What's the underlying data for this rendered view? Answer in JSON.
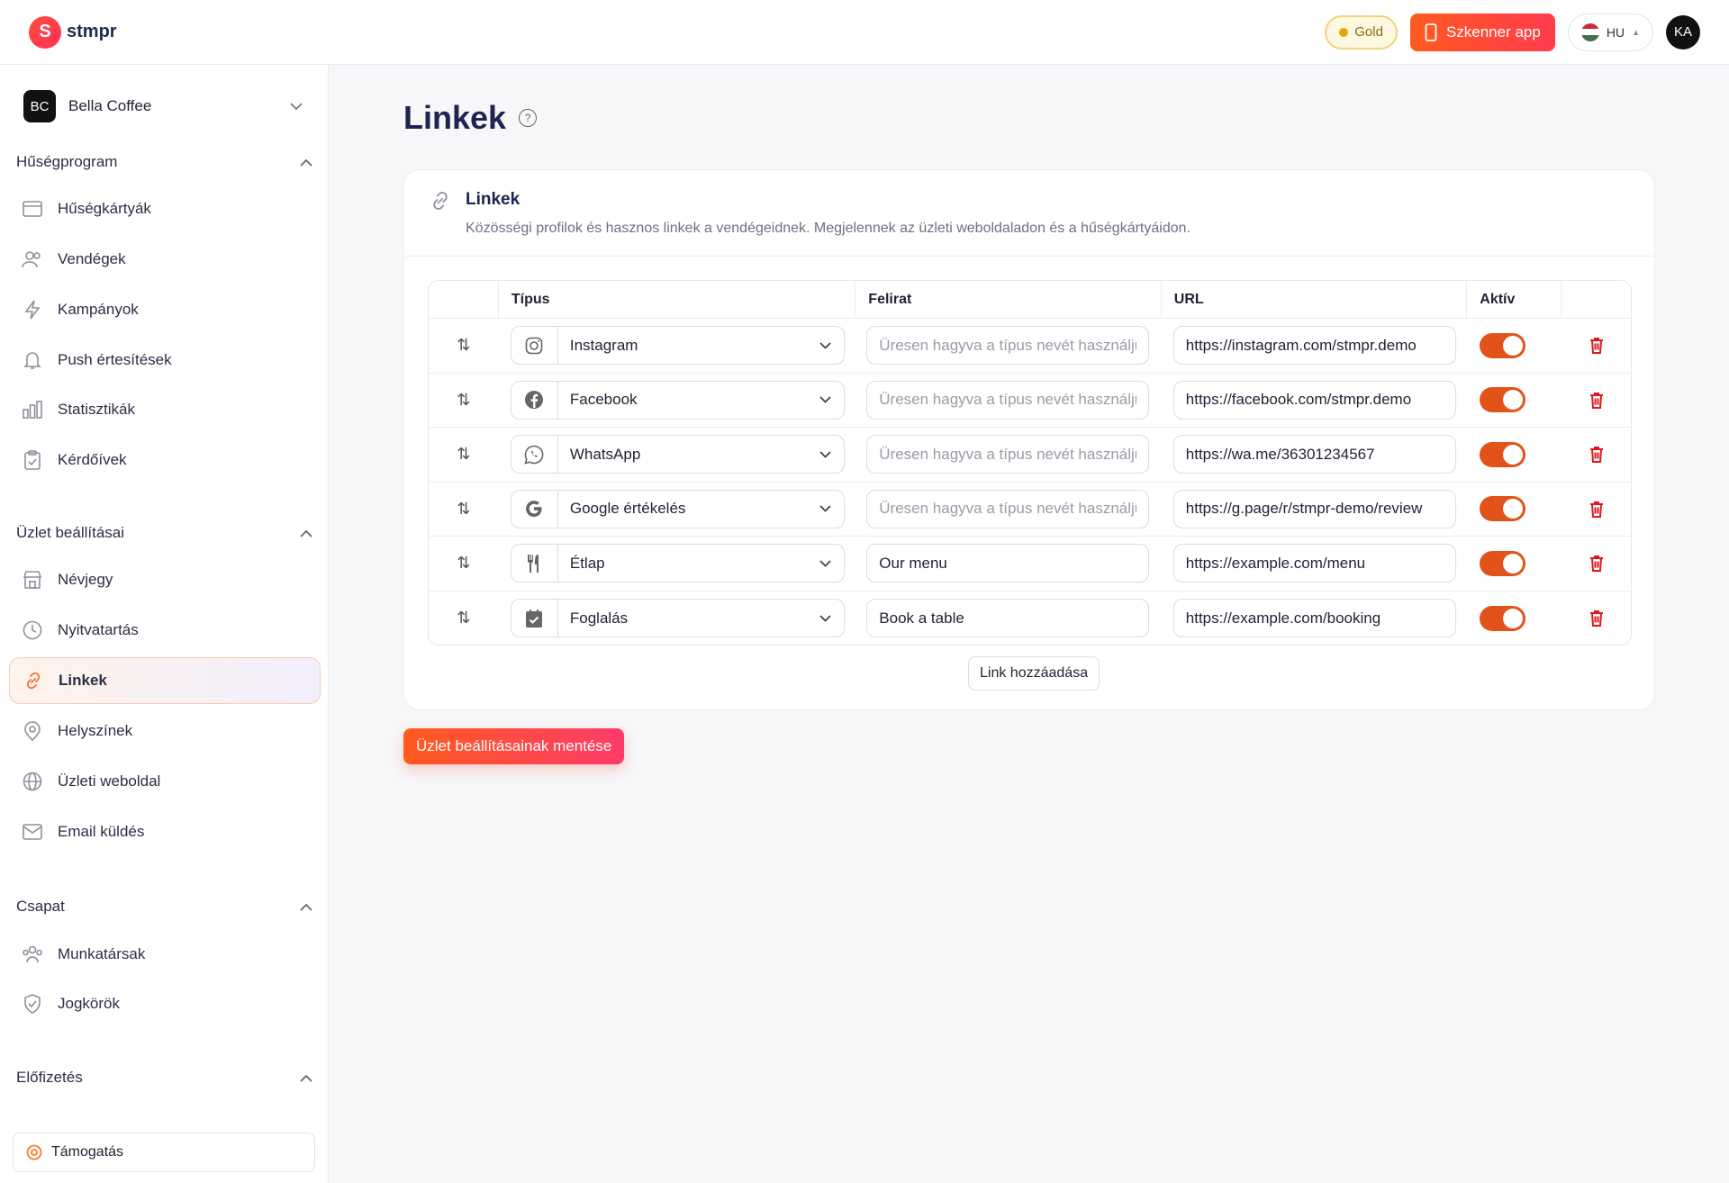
{
  "brand": {
    "name": "stmpr"
  },
  "topbar": {
    "plan_label": "Gold",
    "scanner_label": "Szkenner app",
    "lang_label": "HU",
    "user_initials": "KA"
  },
  "business": {
    "initials": "BC",
    "name": "Bella Coffee"
  },
  "sidebar": {
    "sections": [
      {
        "title": "Hűségprogram"
      },
      {
        "title": "Üzlet beállításai"
      },
      {
        "title": "Csapat"
      },
      {
        "title": "Előfizetés"
      }
    ],
    "items": [
      {
        "label": "Hűségkártyák",
        "icon": "card-icon"
      },
      {
        "label": "Vendégek",
        "icon": "users-icon"
      },
      {
        "label": "Kampányok",
        "icon": "lightning-icon"
      },
      {
        "label": "Push értesítések",
        "icon": "bell-icon"
      },
      {
        "label": "Statisztikák",
        "icon": "chart-icon"
      },
      {
        "label": "Kérdőívek",
        "icon": "clipboard-icon"
      },
      {
        "label": "Névjegy",
        "icon": "store-icon"
      },
      {
        "label": "Nyitvatartás",
        "icon": "clock-icon"
      },
      {
        "label": "Linkek",
        "icon": "link-icon",
        "active": true
      },
      {
        "label": "Helyszínek",
        "icon": "location-icon"
      },
      {
        "label": "Üzleti weboldal",
        "icon": "globe-icon"
      },
      {
        "label": "Email küldés",
        "icon": "mail-icon"
      },
      {
        "label": "Munkatársak",
        "icon": "team-icon"
      },
      {
        "label": "Jogkörök",
        "icon": "shield-icon"
      }
    ],
    "support_label": "Támogatás"
  },
  "page": {
    "title": "Linkek",
    "card_title": "Linkek",
    "card_desc": "Közösségi profilok és hasznos linkek a vendégeidnek. Megjelennek az üzleti weboldaladon és a hűségkártyáidon.",
    "columns": {
      "type": "Típus",
      "label": "Felirat",
      "url": "URL",
      "active": "Aktív"
    },
    "label_placeholder": "Üresen hagyva a típus nevét használjuk",
    "rows": [
      {
        "type": "Instagram",
        "icon": "instagram-icon",
        "label": "",
        "url": "https://instagram.com/stmpr.demo",
        "active": true
      },
      {
        "type": "Facebook",
        "icon": "facebook-icon",
        "label": "",
        "url": "https://facebook.com/stmpr.demo",
        "active": true
      },
      {
        "type": "WhatsApp",
        "icon": "whatsapp-icon",
        "label": "",
        "url": "https://wa.me/36301234567",
        "active": true
      },
      {
        "type": "Google értékelés",
        "icon": "google-icon",
        "label": "",
        "url": "https://g.page/r/stmpr-demo/review",
        "active": true
      },
      {
        "type": "Étlap",
        "icon": "menu-icon",
        "label": "Our menu",
        "url": "https://example.com/menu",
        "active": true
      },
      {
        "type": "Foglalás",
        "icon": "calendar-icon",
        "label": "Book a table",
        "url": "https://example.com/booking",
        "active": true
      }
    ],
    "add_label": "Link hozzáadása",
    "save_label": "Üzlet beállításainak mentése"
  }
}
